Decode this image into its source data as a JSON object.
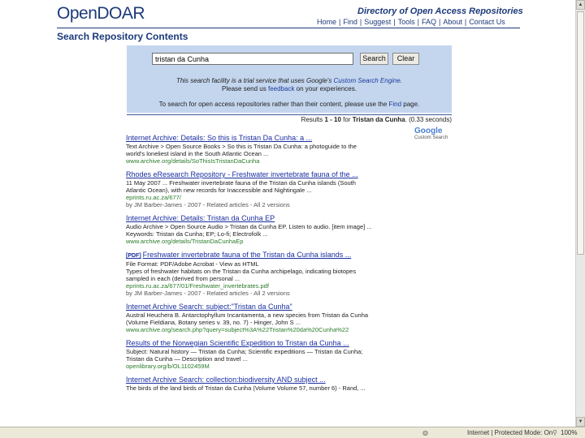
{
  "header": {
    "logo_open": "Open",
    "logo_doar": "DOAR",
    "site_title": "Directory of Open Access Repositories",
    "nav": [
      "Home",
      "Find",
      "Suggest",
      "Tools",
      "FAQ",
      "About",
      "Contact Us"
    ]
  },
  "page_heading": "Search Repository Contents",
  "search": {
    "query": "tristan da Cunha",
    "search_label": "Search",
    "clear_label": "Clear",
    "info_line1_prefix": "This search facility is a trial service that uses Google's ",
    "info_line1_link": "Custom Search Engine",
    "info_line1_suffix": ".",
    "info_line2_prefix": "Please send us ",
    "info_line2_link": "feedback",
    "info_line2_suffix": " on your experiences.",
    "info_line3_prefix": "To search for open access repositories rather than their content, please use the ",
    "info_line3_link": "Find",
    "info_line3_suffix": " page."
  },
  "results_summary": {
    "prefix": "Results ",
    "range": "1 - 10",
    "middle": " for ",
    "query": "Tristan da Cunha",
    "suffix": ". (0.33 seconds)"
  },
  "google_logo": {
    "text": "Google",
    "sub": "Custom Search"
  },
  "results": [
    {
      "title": "Internet Archive: Details: So this is Tristan Da Cunha: a ...",
      "snippet": "Text Archive > Open Source Books > So this is Tristan Da Cunha: a photoguide to the\nworld's loneliest island in the South Atlantic Ocean ...",
      "url": "www.archive.org/details/SoThisIsTristanDaCunha",
      "meta": ""
    },
    {
      "title": "Rhodes eResearch Repository - Freshwater invertebrate fauna of the ...",
      "snippet": "11 May 2007 ... Freshwater invertebrate fauna of the Tristan da Cunha islands (South\nAtlantic Ocean), with new records for Inaccessible and Nightingale ...",
      "url": "eprints.ru.ac.za/677/",
      "meta": "by JM Barber-James - 2007 - Related articles - All 2 versions"
    },
    {
      "title": "Internet Archive: Details: Tristan da Cunha EP",
      "snippet": "Audio Archive > Open Source Audio > Tristan da Cunha EP. Listen to audio. [item image] ...\nKeywords: Tristan da Cunha; EP; Lo-fi; Electrofolk ...",
      "url": "www.archive.org/details/TristanDaCunhaEp",
      "meta": ""
    },
    {
      "filetag": "[PDF]",
      "title": "Freshwater invertebrate fauna of the Tristan da Cunha islands ...",
      "snippet": "File Format: PDF/Adobe Acrobat - View as HTML\nTypes of freshwater habitats on the Tristan da Cunha archipelago, indicating biotopes\nsampled in each (derived from personal ...",
      "url": "eprints.ru.ac.za/677/01/Freshwater_invertebrates.pdf",
      "meta": "by JM Barber-James - 2007 - Related articles - All 2 versions"
    },
    {
      "title": "Internet Archive Search: subject:\"Tristan da Cunha\"",
      "snippet": "Austral Heuchera B. Antarctophyllum Incantamenta, a new species from Tristan da Cunha\n(Volume Fieldiana, Botany series v. 39, no. 7) - Hinger, John S ...",
      "url": "www.archive.org/search.php?query=subject%3A%22Tristan%20da%20Cunha%22",
      "meta": ""
    },
    {
      "title": "Results of the Norwegian Scientific Expedition to Tristan da Cunha ...",
      "snippet": "Subject: Natural history — Tristan da Cunha; Scientific expeditions — Tristan da Cunha;\nTristan da Cunha — Description and travel ...",
      "url": "openlibrary.org/b/OL1102459M",
      "meta": ""
    },
    {
      "title": "Internet Archive Search: collection:biodiversity AND subject ...",
      "snippet": "The birds of the land birds of Tristan da Cunha (Volume Volume 57, number 6) - Rand, ...",
      "url": "",
      "meta": ""
    }
  ],
  "status_bar": {
    "zone": "Internet | Protected Mode: On",
    "zoom": "100%"
  }
}
